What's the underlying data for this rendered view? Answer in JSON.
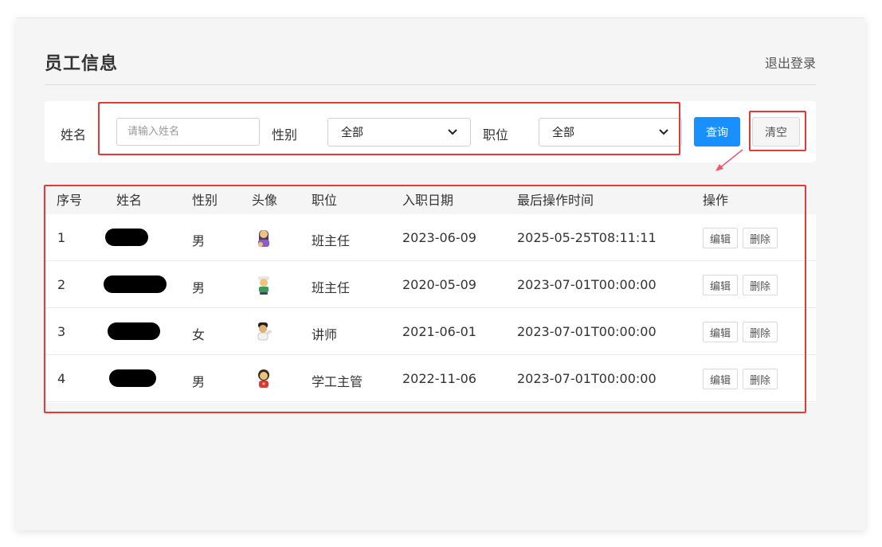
{
  "header": {
    "title": "员工信息",
    "logout_label": "退出登录"
  },
  "search": {
    "name_label": "姓名",
    "name_placeholder": "请输入姓名",
    "name_value": "",
    "gender_label": "性别",
    "gender_selected": "全部",
    "position_label": "职位",
    "position_selected": "全部",
    "query_label": "查询",
    "clear_label": "清空"
  },
  "table": {
    "columns": [
      "序号",
      "姓名",
      "性别",
      "头像",
      "职位",
      "入职日期",
      "最后操作时间",
      "操作"
    ],
    "rows": [
      {
        "index": "1",
        "gender": "男",
        "position": "班主任",
        "entry_date": "2023-06-09",
        "updated": "2025-05-25T08:11:11",
        "edit": "编辑",
        "delete": "删除",
        "avatar_icon": "avatar-icon"
      },
      {
        "index": "2",
        "gender": "男",
        "position": "班主任",
        "entry_date": "2020-05-09",
        "updated": "2023-07-01T00:00:00",
        "edit": "编辑",
        "delete": "删除",
        "avatar_icon": "avatar-icon"
      },
      {
        "index": "3",
        "gender": "女",
        "position": "讲师",
        "entry_date": "2021-06-01",
        "updated": "2023-07-01T00:00:00",
        "edit": "编辑",
        "delete": "删除",
        "avatar_icon": "avatar-icon"
      },
      {
        "index": "4",
        "gender": "男",
        "position": "学工主管",
        "entry_date": "2022-11-06",
        "updated": "2023-07-01T00:00:00",
        "edit": "编辑",
        "delete": "删除",
        "avatar_icon": "avatar-icon"
      }
    ]
  },
  "colors": {
    "primary": "#1890ff",
    "annotation": "#e23a3a",
    "background": "#f5f5f5"
  }
}
